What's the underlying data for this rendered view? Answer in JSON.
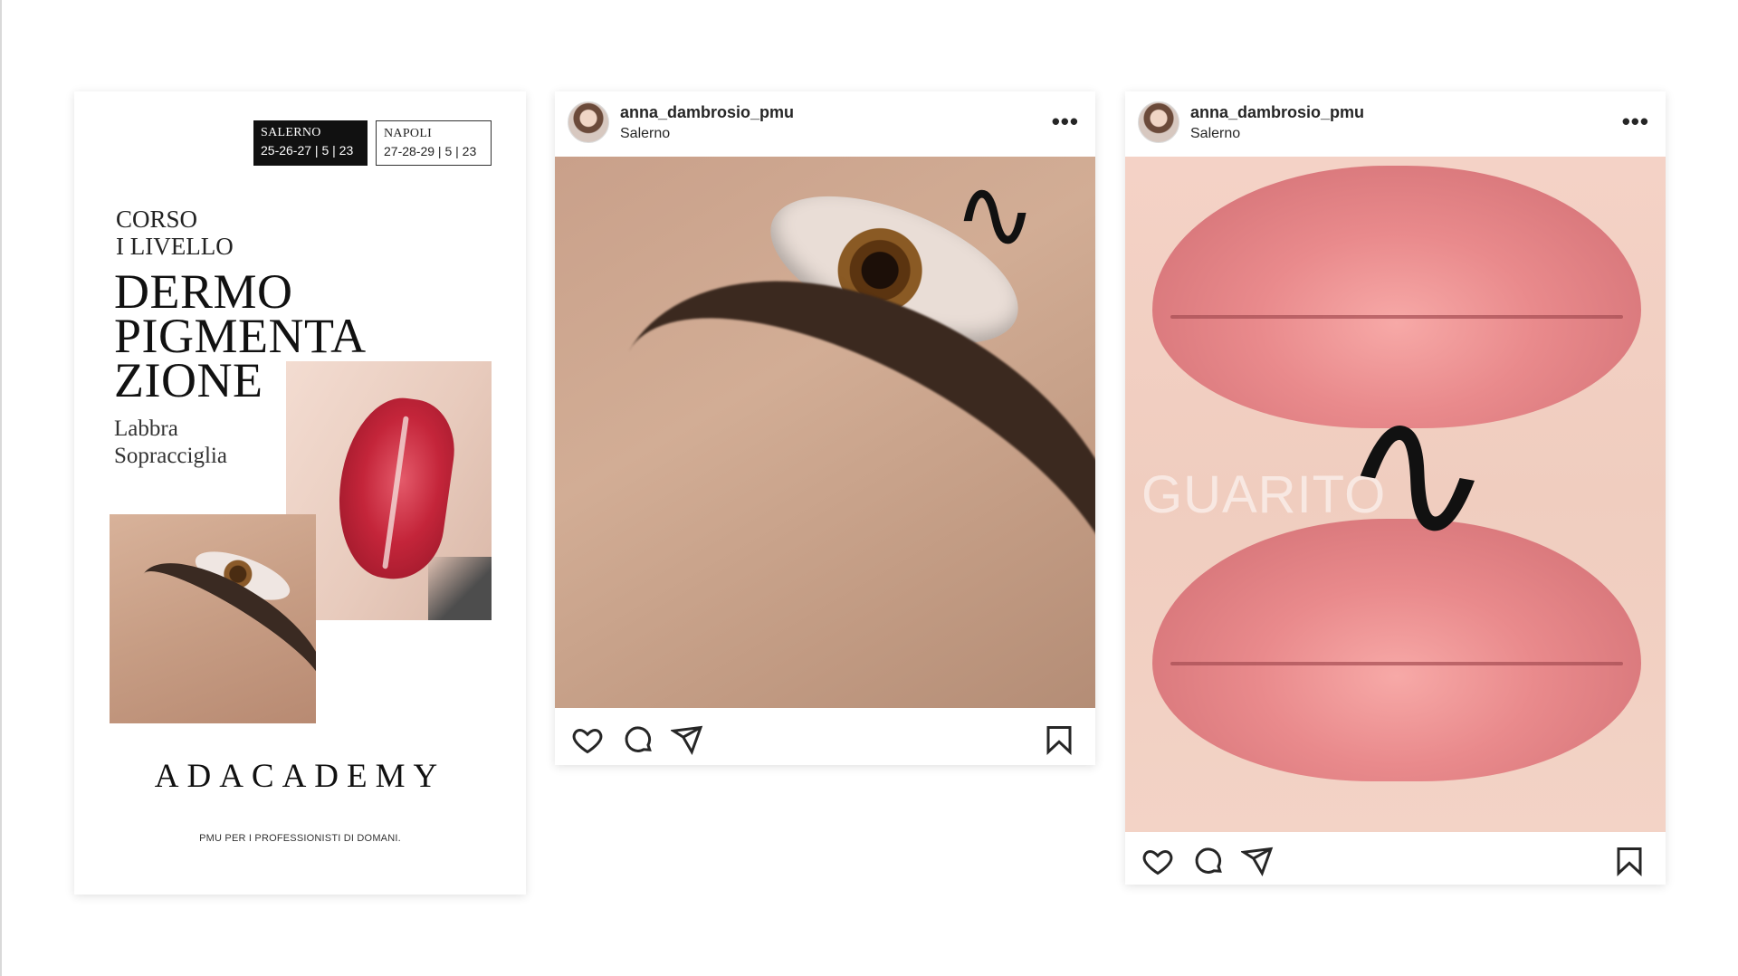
{
  "poster": {
    "dates": [
      {
        "city": "SALERNO",
        "days": "25-26-27 | 5 | 23"
      },
      {
        "city": "NAPOLI",
        "days": "27-28-29 | 5 | 23"
      }
    ],
    "course_line1": "CORSO",
    "course_line2": "I LIVELLO",
    "title_lines": [
      "DERMO",
      "PIGMENTA",
      "ZIONE"
    ],
    "subtitle_lines": [
      "Labbra",
      "Sopracciglia"
    ],
    "logo": "ADACADEMY",
    "tagline": "PMU PER I PROFESSIONISTI DI DOMANI."
  },
  "posts": [
    {
      "username": "anna_dambrosio_pmu",
      "location": "Salerno",
      "more": "•••"
    },
    {
      "username": "anna_dambrosio_pmu",
      "location": "Salerno",
      "more": "•••",
      "overlay_text": "GUARITO"
    }
  ],
  "decor": {
    "swirl": "∿"
  },
  "icons": {
    "like": "heart-icon",
    "comment": "comment-icon",
    "share": "send-icon",
    "save": "bookmark-icon",
    "more": "ellipsis-icon"
  },
  "colors": {
    "ink": "#262626",
    "lip_red": "#c4253a",
    "brow_brown": "#3b291f",
    "lip_pink": "#e98a8c"
  }
}
